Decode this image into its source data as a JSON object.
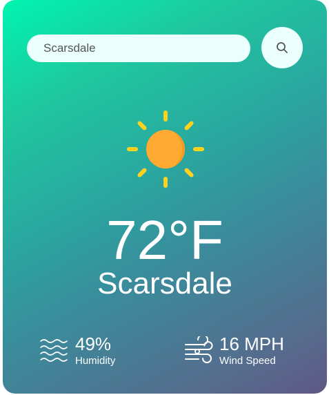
{
  "search": {
    "value": "Scarsdale",
    "button_icon": "search-icon"
  },
  "weather": {
    "icon": "sun-icon",
    "temperature": "72°F",
    "city": "Scarsdale"
  },
  "details": {
    "humidity": {
      "icon": "humidity-icon",
      "value": "49%",
      "label": "Humidity"
    },
    "wind": {
      "icon": "wind-icon",
      "value": "16 MPH",
      "label": "Wind Speed"
    }
  },
  "colors": {
    "gradient_start": "#00f5b0",
    "gradient_end": "#5f5885",
    "input_background": "#ebfffc",
    "sun_core": "#ffaa33",
    "sun_rays": "#ffd21f"
  }
}
